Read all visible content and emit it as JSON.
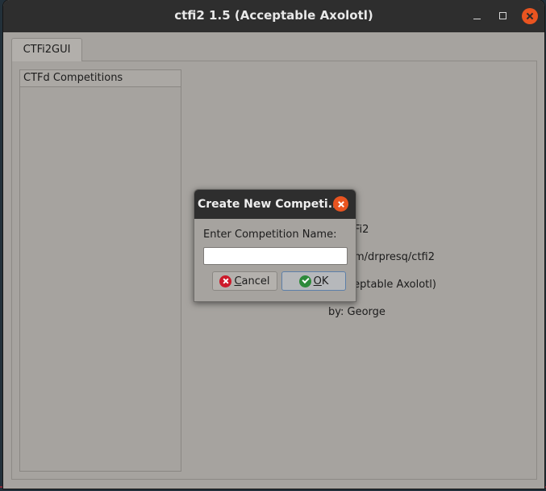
{
  "window": {
    "title": "ctfi2 1.5 (Acceptable Axolotl)"
  },
  "tabs": [
    {
      "label": "CTFi2GUI"
    }
  ],
  "list": {
    "header": "CTFd Competitions",
    "items": []
  },
  "info": {
    "line1": "TFi2",
    "line2": "om/drpresq/ctfi2",
    "line3": "ceptable Axolotl)",
    "line4": "by: George"
  },
  "dialog": {
    "title": "Create New Competi...",
    "prompt": "Enter Competition Name:",
    "input_value": "",
    "cancel_mnemonic": "C",
    "cancel_rest": "ancel",
    "ok_mnemonic": "O",
    "ok_rest": "K"
  },
  "icons": {
    "close": "close-icon",
    "minimize": "minimize-icon",
    "maximize": "maximize-icon",
    "cancel": "cancel-icon",
    "ok": "checkmark-icon"
  },
  "colors": {
    "accent": "#e95420",
    "cancel_icon": "#cc1a2a",
    "ok_icon": "#2d8a3a",
    "titlebar": "#2e2e2e",
    "window_bg": "#a6a39f"
  }
}
